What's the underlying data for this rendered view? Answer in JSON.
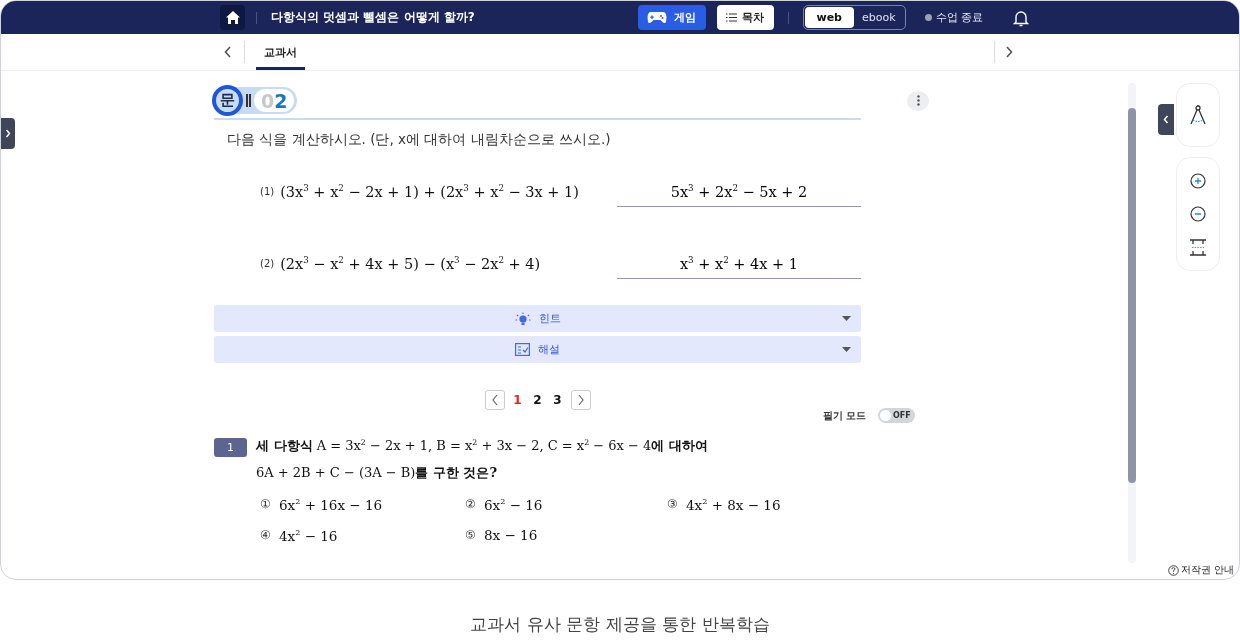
{
  "top_bar": {
    "title": "다항식의 덧셈과 뺄셈은 어떻게 할까?",
    "game_button": "게임",
    "toc_button": "목차",
    "view_modes": [
      {
        "label": "web",
        "selected": true
      },
      {
        "label": "ebook",
        "selected": false
      }
    ],
    "end_class": "수업 종료"
  },
  "tabs": [
    {
      "label": "교과서",
      "selected": true
    }
  ],
  "problem": {
    "badge_label": "문",
    "number_prefix": "0",
    "number": "2",
    "instruction": "다음 식을 계산하시오. (단, x에 대하여 내림차순으로 쓰시오.)",
    "items": [
      {
        "index": "(1)",
        "expression": "(3x$^{3}$ + x$^{2}$ − 2x + 1) + (2x$^{3}$ + x$^{2}$ − 3x + 1)",
        "answer": "5x$^{3}$ + 2x$^{2}$ − 5x + 2"
      },
      {
        "index": "(2)",
        "expression": "(2x$^{3}$ − x$^{2}$ + 4x + 5) − (x$^{3}$ − 2x$^{2}$ + 4)",
        "answer": "x$^{3}$ + x$^{2}$ + 4x + 1"
      }
    ],
    "panels": [
      {
        "kind": "hint",
        "label": "힌트",
        "expanded": false
      },
      {
        "kind": "solution",
        "label": "해설",
        "expanded": false
      }
    ]
  },
  "pagination": [
    {
      "label": "1",
      "selected": true
    },
    {
      "label": "2",
      "selected": false
    },
    {
      "label": "3",
      "selected": false
    }
  ],
  "handwriting_mode": {
    "label": "필기 모드",
    "state": "OFF",
    "on": false
  },
  "question": {
    "number": "1",
    "lines": [
      "**세 다항식** A = 3x$^{2}$ − 2x + 1, B = x$^{2}$ + 3x − 2, C = x$^{2}$ − 6x − 4**에 대하여**",
      "6A + 2B + C − (3A − B)**를 구한 것은?**"
    ],
    "choices": [
      {
        "mark": "①",
        "expression": "6x$^{2}$ + 16x − 16"
      },
      {
        "mark": "②",
        "expression": "6x$^{2}$ − 16"
      },
      {
        "mark": "③",
        "expression": "4x$^{2}$ + 8x − 16"
      },
      {
        "mark": "④",
        "expression": "4x$^{2}$ − 16"
      },
      {
        "mark": "⑤",
        "expression": "8x − 16"
      }
    ]
  },
  "copyright_link": "저작권 안내",
  "caption": "교과서 유사 문항 제공을 통한 반복학습"
}
